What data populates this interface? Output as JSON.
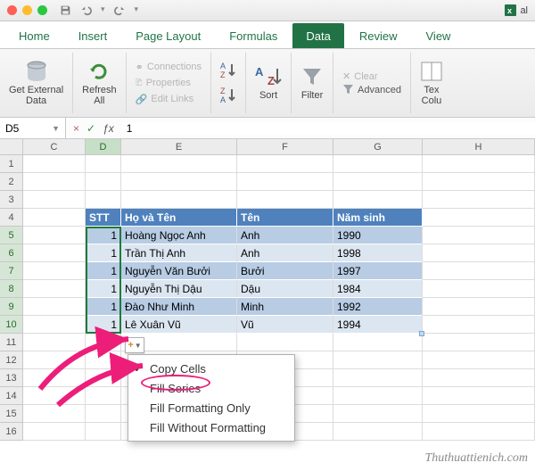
{
  "titlebar": {
    "doc_prefix": "al"
  },
  "tabs": {
    "home": "Home",
    "insert": "Insert",
    "pagelayout": "Page Layout",
    "formulas": "Formulas",
    "data": "Data",
    "review": "Review",
    "view": "View"
  },
  "ribbon": {
    "get_external_data": "Get External\nData",
    "refresh_all": "Refresh\nAll",
    "connections": "Connections",
    "properties": "Properties",
    "edit_links": "Edit Links",
    "sort_az_icon": "A→Z",
    "sort": "Sort",
    "filter": "Filter",
    "clear": "Clear",
    "advanced": "Advanced",
    "text_to_columns": "Tex\nColu"
  },
  "formula_bar": {
    "name_box": "D5",
    "value": "1"
  },
  "columns": [
    "C",
    "D",
    "E",
    "F",
    "G",
    "H"
  ],
  "col_widths": {
    "C": 70,
    "D": 40,
    "E": 130,
    "F": 108,
    "G": 100,
    "H": 126
  },
  "rows": [
    "1",
    "2",
    "3",
    "4",
    "5",
    "6",
    "7",
    "8",
    "9",
    "10",
    "11",
    "12",
    "13",
    "14",
    "15",
    "16"
  ],
  "table": {
    "header": {
      "stt": "STT",
      "name": "Họ và Tên",
      "alias": "Tên",
      "year": "Năm sinh"
    },
    "rows": [
      {
        "stt": "1",
        "name": "Hoàng Ngọc Anh",
        "alias": "Anh",
        "year": "1990"
      },
      {
        "stt": "1",
        "name": "Trần Thị Anh",
        "alias": "Anh",
        "year": "1998"
      },
      {
        "stt": "1",
        "name": "Nguyễn Văn Bưởi",
        "alias": "Bưởi",
        "year": "1997"
      },
      {
        "stt": "1",
        "name": "Nguyễn Thị Dậu",
        "alias": "Dậu",
        "year": "1984"
      },
      {
        "stt": "1",
        "name": "Đào Như Minh",
        "alias": "Minh",
        "year": "1992"
      },
      {
        "stt": "1",
        "name": "Lê Xuân Vũ",
        "alias": "Vũ",
        "year": "1994"
      }
    ]
  },
  "fill_menu": {
    "copy_cells": "Copy Cells",
    "fill_series": "Fill Series",
    "fill_fmt": "Fill Formatting Only",
    "fill_nofmt": "Fill Without Formatting"
  },
  "watermark": "Thuthuattienich.com"
}
